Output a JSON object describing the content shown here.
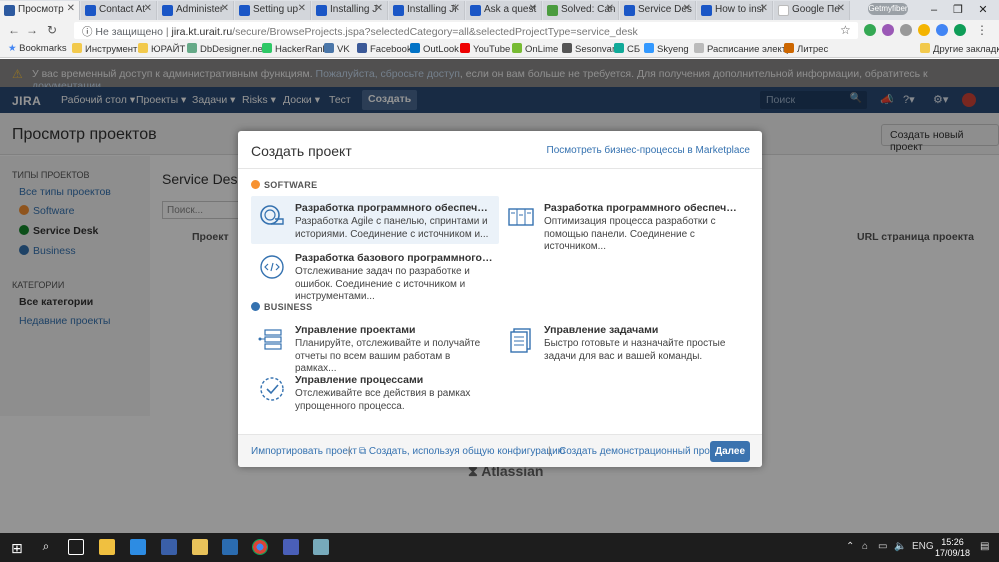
{
  "browser": {
    "tabs": [
      {
        "title": "Просмотр",
        "active": true
      },
      {
        "title": "Contact At"
      },
      {
        "title": "Administer"
      },
      {
        "title": "Setting up"
      },
      {
        "title": "Installing J"
      },
      {
        "title": "Installing Ji"
      },
      {
        "title": "Ask a quest"
      },
      {
        "title": "Solved: Can"
      },
      {
        "title": "Service Des"
      },
      {
        "title": "How to insl"
      },
      {
        "title": "Google Пе"
      }
    ],
    "profile_label": "Getmyfiber",
    "address": {
      "security": "Не защищено",
      "host": "jira.kt.urait.ru",
      "path": "/secure/BrowseProjects.jspa?selectedCategory=all&selectedProjectType=service_desk"
    },
    "bookmarks": [
      "Bookmarks",
      "Инструменты",
      "ЮРАЙТ",
      "DbDesigner.net",
      "HackerRank",
      "VK",
      "Facebook",
      "OutLook",
      "YouTube",
      "OnLime",
      "Sesonvar",
      "СБ",
      "Skyeng",
      "Расписание электрі",
      "Литрес"
    ],
    "other_bookmarks": "Другие закладки",
    "colors": {
      "tabstrip": "#dee1e6",
      "jira_header": "#2a4b75",
      "link": "#3572b0",
      "primary_button": "#3b73af"
    }
  },
  "admin_notice": {
    "text_before": "У вас временный доступ к административным функциям.",
    "link1": "Пожалуйста, сбросьте доступ",
    "text_middle": ", если он вам больше не требуется. Для получения дополнительной информации, обратитесь к",
    "link2": "документации",
    "text_end": "."
  },
  "jira_header": {
    "logo": "JIRA",
    "nav": [
      "Рабочий стол ▾",
      "Проекты ▾",
      "Задачи ▾",
      "Risks ▾",
      "Доски ▾",
      "Тест"
    ],
    "create": "Создать",
    "search_placeholder": "Поиск"
  },
  "page": {
    "title": "Просмотр проектов",
    "create_new": "Создать новый проект",
    "sidebar": {
      "types_heading": "ТИПЫ ПРОЕКТОВ",
      "types": [
        "Все типы проектов",
        "Software",
        "Service Desk",
        "Business"
      ],
      "categories_heading": "КАТЕГОРИИ",
      "categories": [
        "Все категории",
        "Недавние проекты"
      ]
    },
    "content_title": "Service Desk",
    "search_placeholder": "Поиск...",
    "col_project": "Проект",
    "col_url": "URL страница проекта",
    "footer": "Atlassian"
  },
  "dialog": {
    "title": "Создать проект",
    "marketplace": "Посмотреть бизнес-процессы в Marketplace",
    "software_heading": "SOFTWARE",
    "business_heading": "BUSINESS",
    "software_cards": [
      {
        "title": "Разработка программного обеспечения Scr...",
        "desc": "Разработка Agile с панелью, спринтами и историями. Соединение с источником и...",
        "icon": "scrum-icon"
      },
      {
        "title": "Разработка программного обеспечения Ка...",
        "desc": "Оптимизация процесса разработки с помощью панели. Соединение с источником...",
        "icon": "kanban-icon"
      },
      {
        "title": "Разработка базового программного обеспе...",
        "desc": "Отслеживание задач по разработке и ошибок. Соединение с источником и инструментами...",
        "icon": "code-icon"
      }
    ],
    "business_cards": [
      {
        "title": "Управление проектами",
        "desc": "Планируйте, отслеживайте и получайте отчеты по всем вашим работам в рамках...",
        "icon": "project-management-icon"
      },
      {
        "title": "Управление задачами",
        "desc": "Быстро готовьте и назначайте простые задачи для вас и вашей команды.",
        "icon": "task-management-icon"
      },
      {
        "title": "Управление процессами",
        "desc": "Отслеживайте все действия в рамках упрощенного процесса.",
        "icon": "process-management-icon"
      }
    ],
    "footer": {
      "import": "Импортировать проект",
      "shared": "Создать, используя общую конфигурацию",
      "demo": "Создать демонстрационный проект",
      "next": "Далее"
    }
  },
  "taskbar": {
    "lang": "ENG",
    "time": "15:26",
    "date": "17/09/18"
  }
}
